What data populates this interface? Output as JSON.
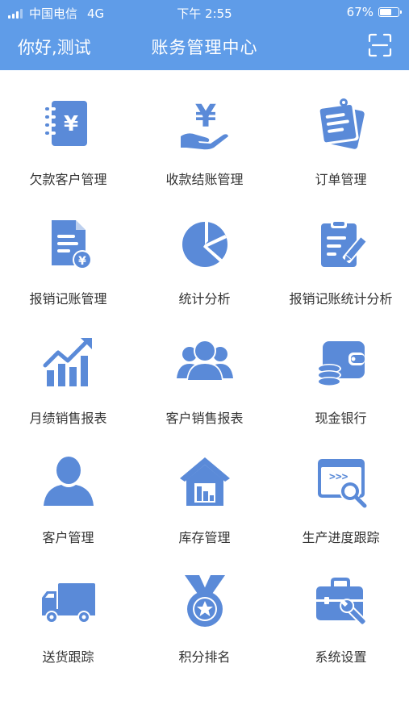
{
  "status_bar": {
    "carrier": "中国电信",
    "network": "4G",
    "time": "下午 2:55",
    "battery": "67%",
    "battery_level": 0.67
  },
  "header": {
    "greeting": "你好,测试",
    "title": "账务管理中心",
    "scan_icon": "scan-icon"
  },
  "menu": [
    {
      "label": "欠款客户管理",
      "icon": "yen-notebook-icon"
    },
    {
      "label": "收款结账管理",
      "icon": "yen-hand-icon"
    },
    {
      "label": "订单管理",
      "icon": "order-notes-icon"
    },
    {
      "label": "报销记账管理",
      "icon": "document-yen-icon"
    },
    {
      "label": "统计分析",
      "icon": "pie-chart-icon"
    },
    {
      "label": "报销记账统计分析",
      "icon": "clipboard-pen-icon"
    },
    {
      "label": "月绩销售报表",
      "icon": "bar-chart-arrow-icon"
    },
    {
      "label": "客户销售报表",
      "icon": "user-group-icon"
    },
    {
      "label": "现金银行",
      "icon": "wallet-coins-icon"
    },
    {
      "label": "客户管理",
      "icon": "user-icon"
    },
    {
      "label": "库存管理",
      "icon": "warehouse-icon"
    },
    {
      "label": "生产进度跟踪",
      "icon": "code-search-icon"
    },
    {
      "label": "送货跟踪",
      "icon": "truck-icon"
    },
    {
      "label": "积分排名",
      "icon": "medal-icon"
    },
    {
      "label": "系统设置",
      "icon": "toolbox-icon"
    }
  ],
  "colors": {
    "header_bg": "#5f9ce8",
    "icon": "#5a8ad8",
    "label": "#333333"
  }
}
